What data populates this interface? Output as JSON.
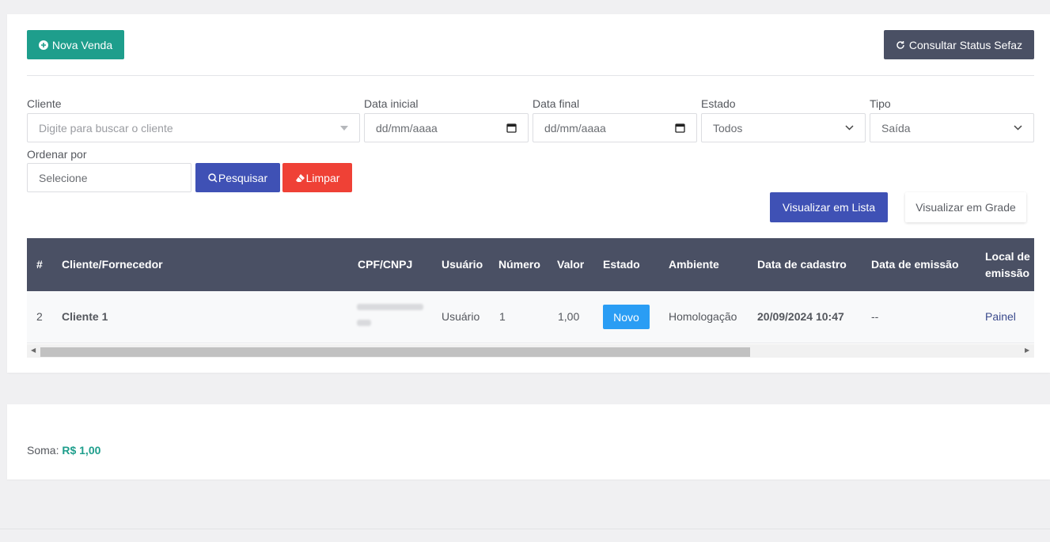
{
  "toolbar": {
    "nova_venda": "Nova Venda",
    "consultar_sefaz": "Consultar Status Sefaz"
  },
  "filters": {
    "cliente_label": "Cliente",
    "cliente_placeholder": "Digite para buscar o cliente",
    "data_inicial_label": "Data inicial",
    "data_inicial_value": "dd/mm/aaaa",
    "data_final_label": "Data final",
    "data_final_value": "dd/mm/aaaa",
    "estado_label": "Estado",
    "estado_value": "Todos",
    "tipo_label": "Tipo",
    "tipo_value": "Saída",
    "ordenar_label": "Ordenar por",
    "ordenar_value": "Selecione",
    "pesquisar": "Pesquisar",
    "limpar": "Limpar"
  },
  "view": {
    "lista": "Visualizar em Lista",
    "grade": "Visualizar em Grade"
  },
  "table": {
    "headers": [
      "#",
      "Cliente/Fornecedor",
      "CPF/CNPJ",
      "Usuário",
      "Número",
      "Valor",
      "Estado",
      "Ambiente",
      "Data de cadastro",
      "Data de emissão",
      "Local de",
      "emissão"
    ],
    "rows": [
      {
        "id": "2",
        "cliente": "Cliente 1",
        "usuario": "Usuário",
        "numero": "1",
        "valor": "1,00",
        "estado": "Novo",
        "ambiente": "Homologação",
        "data_cadastro": "20/09/2024 10:47",
        "data_emissao": "--",
        "local": "Painel"
      }
    ]
  },
  "summary": {
    "label": "Soma:",
    "value": "R$ 1,00"
  },
  "colors": {
    "teal": "#1e9e8c",
    "dark": "#4a5064",
    "primary": "#3f51b5",
    "danger": "#ef4136",
    "badge": "#2a9df4"
  }
}
